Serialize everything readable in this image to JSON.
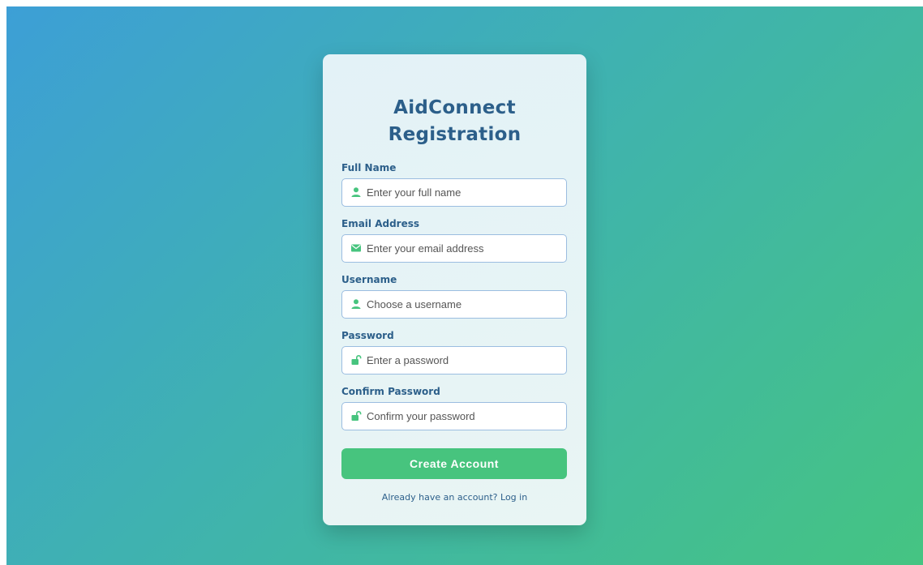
{
  "page": {
    "title_line1": "AidConnect",
    "title_line2": "Registration"
  },
  "form": {
    "fields": [
      {
        "label": "Full Name",
        "placeholder": "Enter your full name",
        "value": "",
        "icon": "user-icon"
      },
      {
        "label": "Email Address",
        "placeholder": "Enter your email address",
        "value": "",
        "icon": "envelope-icon"
      },
      {
        "label": "Username",
        "placeholder": "Choose a username",
        "value": "",
        "icon": "user-icon"
      },
      {
        "label": "Password",
        "placeholder": "Enter a password",
        "value": "",
        "icon": "unlock-icon"
      },
      {
        "label": "Confirm Password",
        "placeholder": "Confirm your password",
        "value": "",
        "icon": "unlock-icon"
      }
    ],
    "submit_label": "Create Account",
    "login_prompt": "Already have an account? Log in"
  },
  "colors": {
    "background_start": "#3d9fd6",
    "background_end": "#45c482",
    "heading": "#2c5f8a",
    "accent": "#47c47e",
    "input_border": "#9bbde0",
    "icon": "#47c47e"
  }
}
